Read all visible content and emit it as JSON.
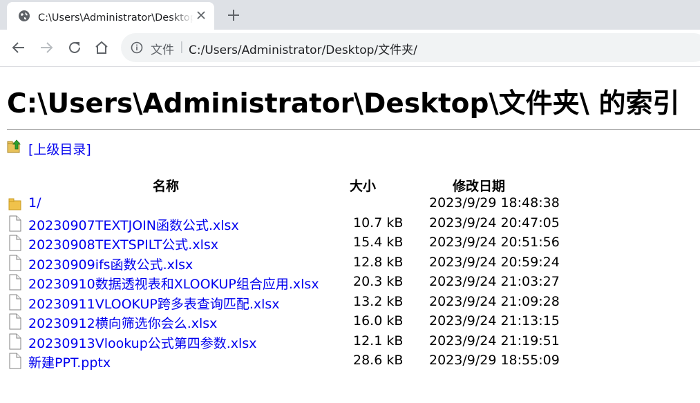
{
  "tab": {
    "title": "C:\\Users\\Administrator\\Desktop\\文件夹\\",
    "favicon": "globe-icon",
    "close": "close-icon"
  },
  "new_tab_icon": "plus-icon",
  "nav": {
    "back": "back-arrow-icon",
    "forward": "forward-arrow-icon",
    "reload": "reload-icon",
    "home": "home-icon"
  },
  "omnibox": {
    "info_icon": "info-icon",
    "scheme_label": "文件",
    "separator": "|",
    "url": "C:/Users/Administrator/Desktop/文件夹/"
  },
  "page": {
    "heading": "C:\\Users\\Administrator\\Desktop\\文件夹\\ 的索引",
    "parent_link": "[上级目录]",
    "columns": {
      "name": "名称",
      "size": "大小",
      "modified": "修改日期"
    }
  },
  "files": [
    {
      "type": "folder",
      "name": "1/",
      "size": "",
      "modified": "2023/9/29 18:48:38"
    },
    {
      "type": "file",
      "name": "20230907TEXTJOIN函数公式.xlsx",
      "size": "10.7 kB",
      "modified": "2023/9/24 20:47:05"
    },
    {
      "type": "file",
      "name": "20230908TEXTSPILT公式.xlsx",
      "size": "15.4 kB",
      "modified": "2023/9/24 20:51:56"
    },
    {
      "type": "file",
      "name": "20230909ifs函数公式.xlsx",
      "size": "12.8 kB",
      "modified": "2023/9/24 20:59:24"
    },
    {
      "type": "file",
      "name": "20230910数据透视表和XLOOKUP组合应用.xlsx",
      "size": "20.3 kB",
      "modified": "2023/9/24 21:03:27"
    },
    {
      "type": "file",
      "name": "20230911VLOOKUP跨多表查询匹配.xlsx",
      "size": "13.2 kB",
      "modified": "2023/9/24 21:09:28"
    },
    {
      "type": "file",
      "name": "20230912横向筛选你会么.xlsx",
      "size": "16.0 kB",
      "modified": "2023/9/24 21:13:15"
    },
    {
      "type": "file",
      "name": "20230913Vlookup公式第四参数.xlsx",
      "size": "12.1 kB",
      "modified": "2023/9/24 21:19:51"
    },
    {
      "type": "file",
      "name": "新建PPT.pptx",
      "size": "28.6 kB",
      "modified": "2023/9/29 18:55:09"
    }
  ],
  "colors": {
    "link": "#0000ee",
    "tabstrip": "#dee1e6",
    "omnibox": "#f1f3f4",
    "folder": "#f0c24b"
  }
}
